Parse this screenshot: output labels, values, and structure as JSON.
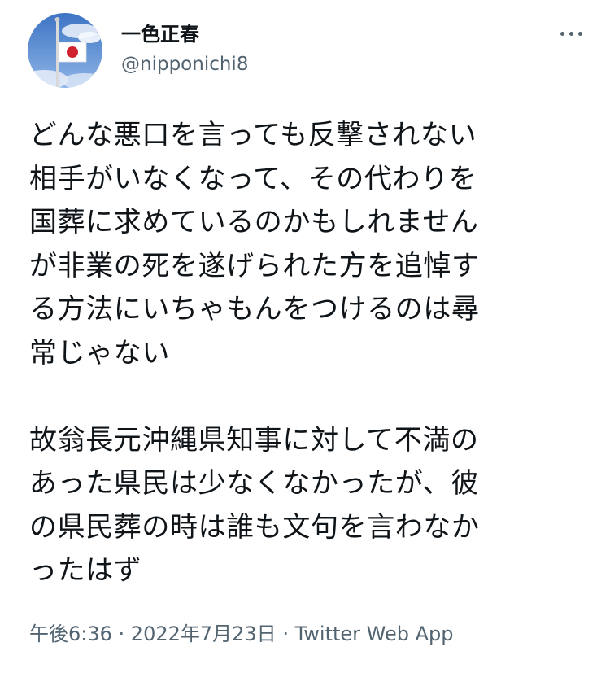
{
  "author": {
    "display_name": "一色正春",
    "handle": "@nipponichi8",
    "avatar_icon": "japan-flag-half-mast-icon"
  },
  "menu": {
    "icon": "more-horizontal-icon"
  },
  "tweet": {
    "paragraphs": [
      {
        "lines": [
          "どんな悪口を言っても反撃されない",
          "相手がいなくなって、その代わりを",
          "国葬に求めているのかもしれません",
          "が非業の死を遂げられた方を追悼す",
          "る方法にいちゃもんをつけるのは尋",
          "常じゃない"
        ]
      },
      {
        "lines": [
          "故翁長元沖縄県知事に対して不満の",
          "あった県民は少なくなかったが、彼",
          "の県民葬の時は誰も文句を言わなか",
          "ったはず"
        ]
      }
    ]
  },
  "meta": {
    "time": "午後6:36",
    "separator": " · ",
    "date": "2022年7月23日",
    "source": "Twitter Web App"
  },
  "colors": {
    "text_primary": "#0f1419",
    "text_secondary": "#536471",
    "background": "#ffffff"
  }
}
